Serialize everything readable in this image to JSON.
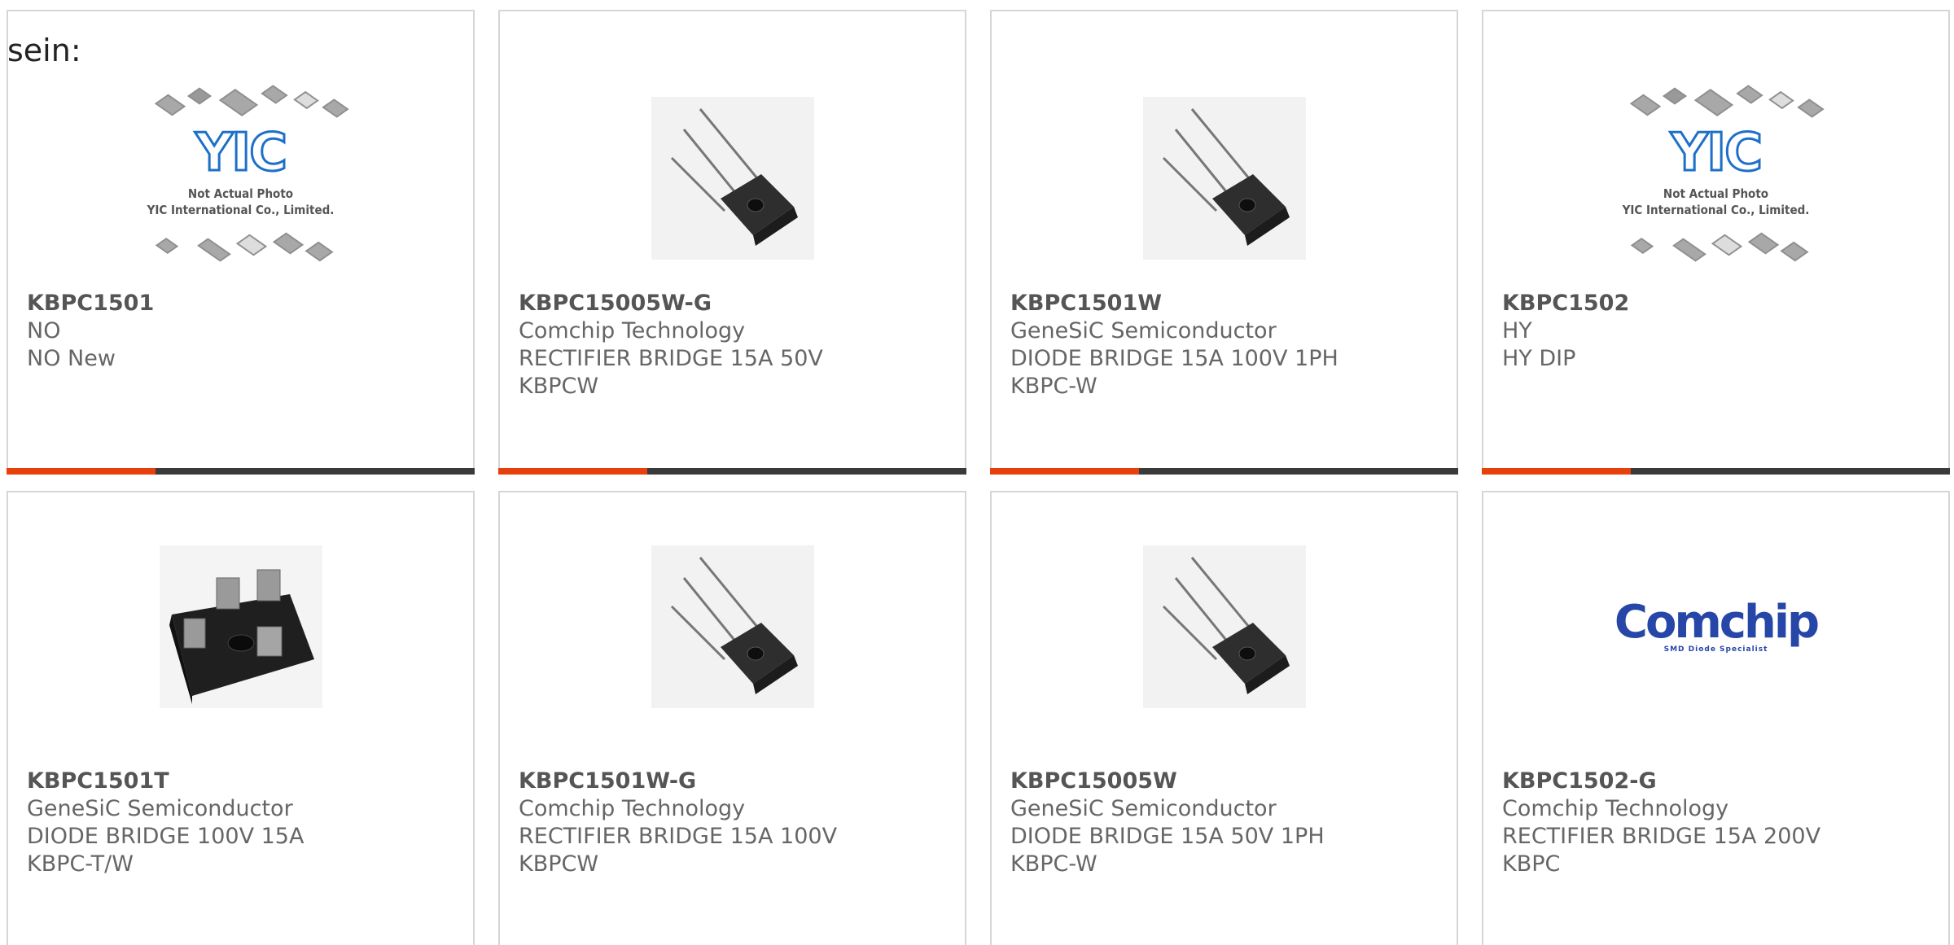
{
  "lead_text": "sein:",
  "accent_color": "#e8400c",
  "bar_color": "#3a3a3a",
  "yic_placeholder": {
    "logo": "YIC",
    "caption_line1": "Not Actual Photo",
    "caption_line2": "YIC International Co., Limited."
  },
  "comchip_logo": {
    "word": "Comchip",
    "tagline": "SMD Diode Specialist"
  },
  "products": [
    {
      "part": "KBPC1501",
      "manufacturer": "NO",
      "description": "NO New",
      "image": "yic-placeholder"
    },
    {
      "part": "KBPC15005W-G",
      "manufacturer": "Comchip Technology",
      "description": "RECTIFIER BRIDGE 15A 50V KBPCW",
      "image": "bridge-rectifier-wire"
    },
    {
      "part": "KBPC1501W",
      "manufacturer": "GeneSiC Semiconductor",
      "description": "DIODE BRIDGE 15A 100V 1PH KBPC-W",
      "image": "bridge-rectifier-wire"
    },
    {
      "part": "KBPC1502",
      "manufacturer": "HY",
      "description": "HY DIP",
      "image": "yic-placeholder"
    },
    {
      "part": "KBPC1501T",
      "manufacturer": "GeneSiC Semiconductor",
      "description": "DIODE BRIDGE 100V 15A KBPC-T/W",
      "image": "bridge-rectifier-terminal"
    },
    {
      "part": "KBPC1501W-G",
      "manufacturer": "Comchip Technology",
      "description": "RECTIFIER BRIDGE 15A 100V KBPCW",
      "image": "bridge-rectifier-wire"
    },
    {
      "part": "KBPC15005W",
      "manufacturer": "GeneSiC Semiconductor",
      "description": "DIODE BRIDGE 15A 50V 1PH KBPC-W",
      "image": "bridge-rectifier-wire"
    },
    {
      "part": "KBPC1502-G",
      "manufacturer": "Comchip Technology",
      "description": "RECTIFIER BRIDGE 15A 200V KBPC",
      "image": "comchip-logo"
    }
  ]
}
